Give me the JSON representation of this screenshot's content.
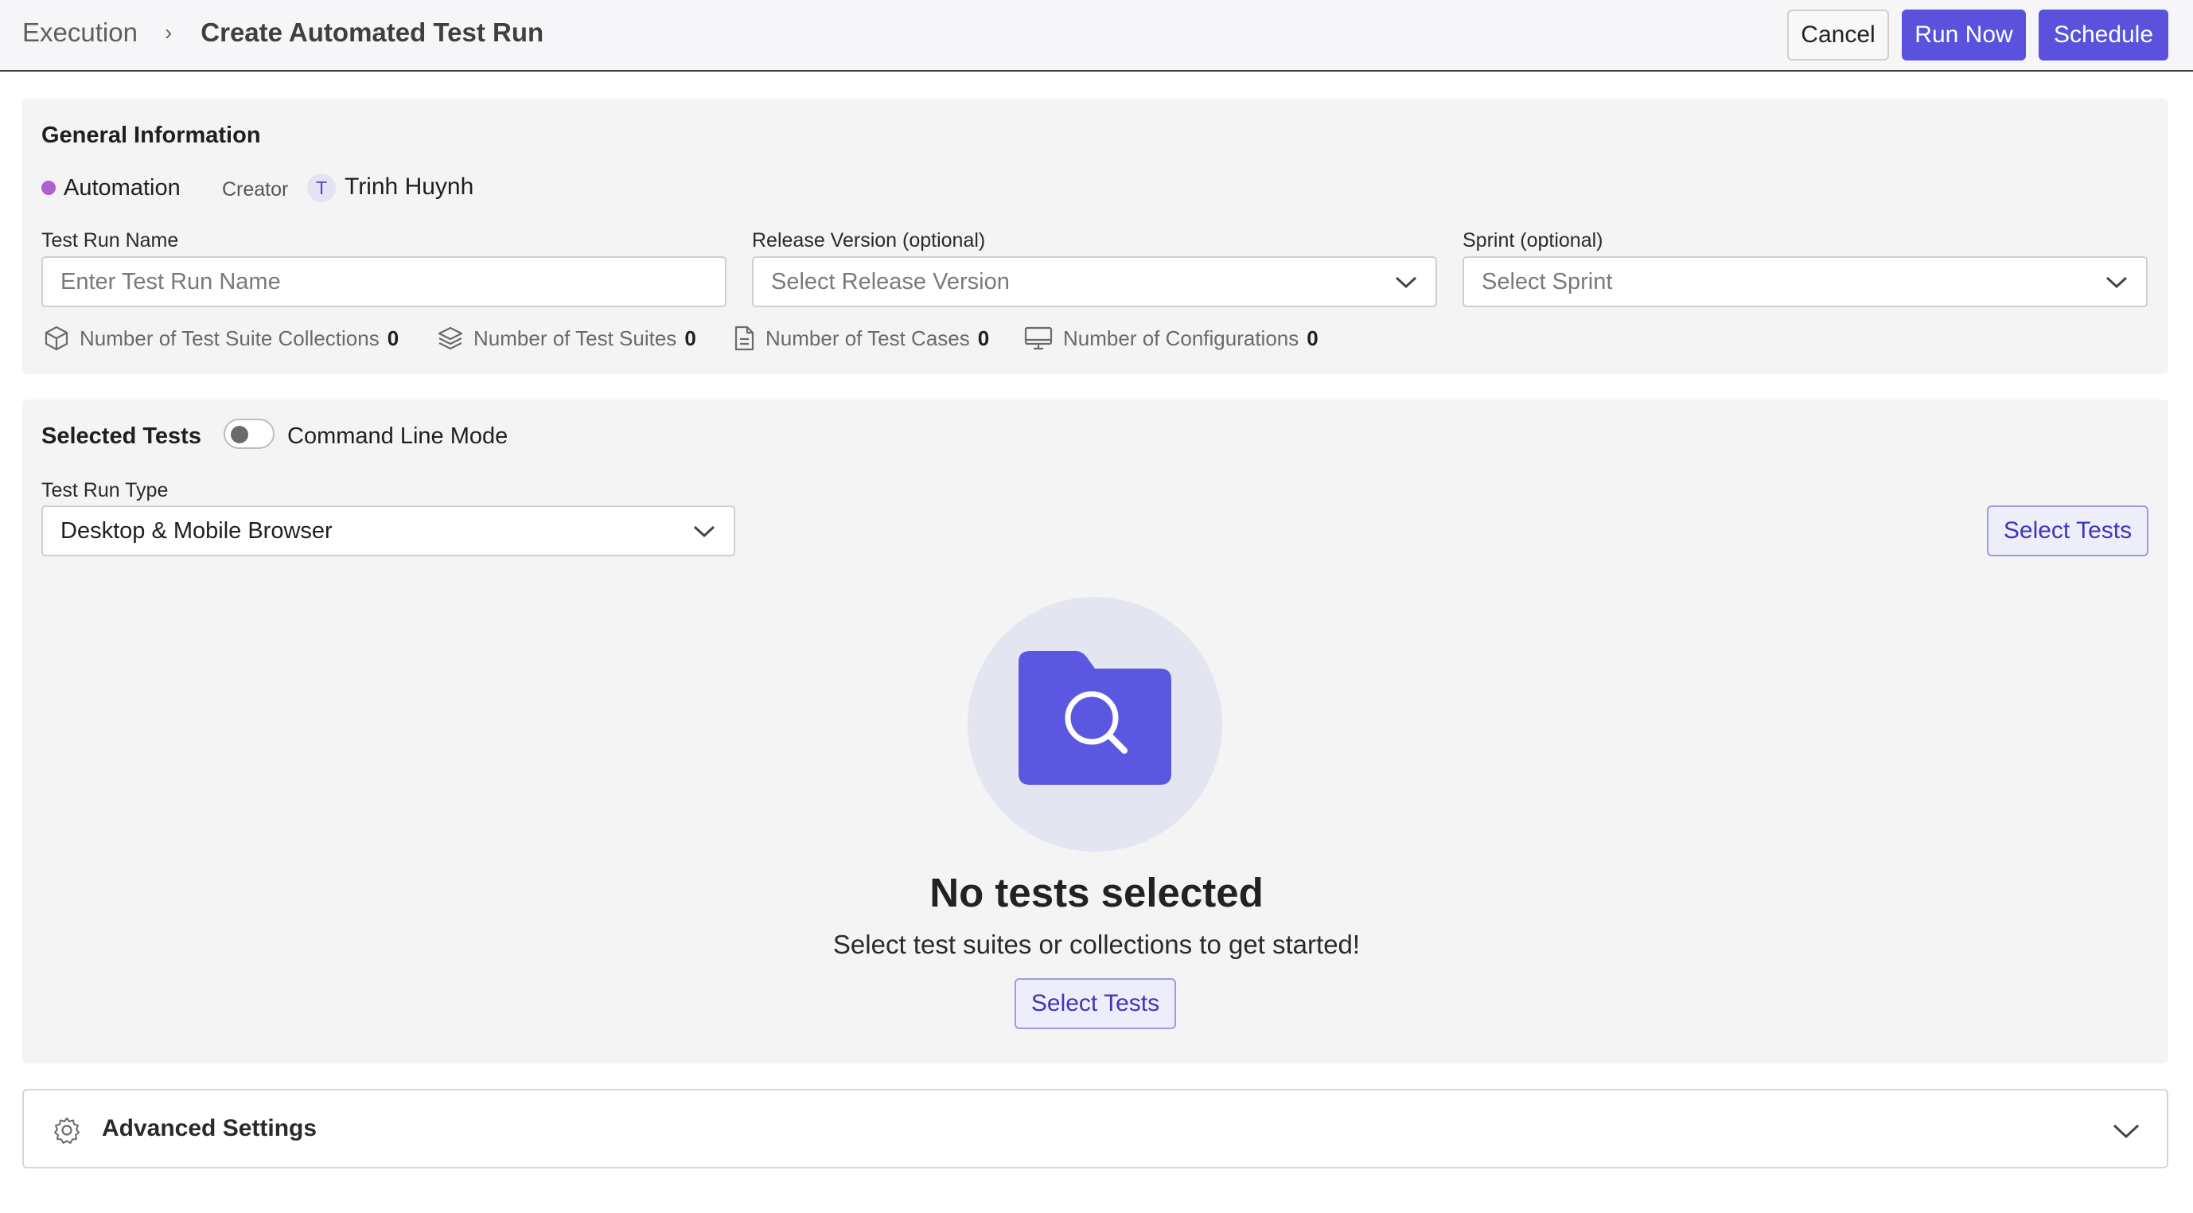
{
  "header": {
    "breadcrumb_root": "Execution",
    "breadcrumb_separator": "›",
    "page_title": "Create Automated Test Run",
    "cancel_label": "Cancel",
    "run_now_label": "Run Now",
    "schedule_label": "Schedule"
  },
  "general": {
    "title": "General Information",
    "type_label": "Automation",
    "type_color": "#b05fd0",
    "creator_label": "Creator",
    "creator_initial": "T",
    "creator_name": "Trinh Huynh",
    "test_run_name_label": "Test Run Name",
    "test_run_name_placeholder": "Enter Test Run Name",
    "release_label": "Release Version (optional)",
    "release_placeholder": "Select Release Version",
    "sprint_label": "Sprint (optional)",
    "sprint_placeholder": "Select Sprint",
    "stats": [
      {
        "label": "Number of Test Suite Collections",
        "value": "0",
        "icon": "box-icon"
      },
      {
        "label": "Number of Test Suites",
        "value": "0",
        "icon": "layers-icon"
      },
      {
        "label": "Number of Test Cases",
        "value": "0",
        "icon": "document-icon"
      },
      {
        "label": "Number of Configurations",
        "value": "0",
        "icon": "monitor-icon"
      }
    ]
  },
  "selected_tests": {
    "title": "Selected Tests",
    "command_line_label": "Command Line Mode",
    "command_line_enabled": false,
    "run_type_label": "Test Run Type",
    "run_type_value": "Desktop & Mobile Browser",
    "select_tests_label": "Select Tests",
    "empty_title": "No tests selected",
    "empty_subtitle": "Select test suites or collections to get started!",
    "empty_select_label": "Select Tests"
  },
  "advanced": {
    "title": "Advanced Settings"
  },
  "colors": {
    "primary": "#5a52dd",
    "folder": "#5b57e1"
  }
}
